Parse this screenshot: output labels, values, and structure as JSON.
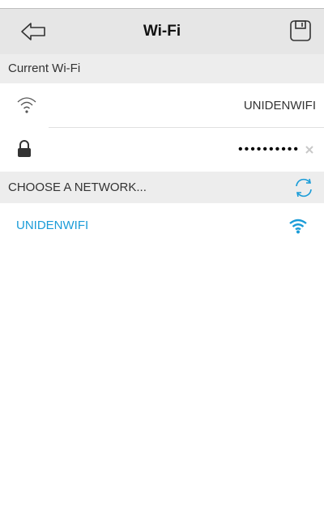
{
  "header": {
    "title": "Wi-Fi",
    "back_icon": "back-arrow-icon",
    "save_icon": "floppy-save-icon"
  },
  "current_wifi": {
    "section_label": "Current Wi-Fi",
    "ssid": "UNIDENWIFI",
    "password_masked": "••••••••••",
    "wifi_icon": "wifi-outline-icon",
    "lock_icon": "lock-icon",
    "clear_icon": "clear-x-icon"
  },
  "choose": {
    "section_label": "CHOOSE A NETWORK...",
    "refresh_icon": "refresh-icon"
  },
  "networks": [
    {
      "name": "UNIDENWIFI",
      "signal_icon": "wifi-signal-icon"
    }
  ],
  "colors": {
    "accent": "#1a9cd8",
    "header_bg": "#e6e6e6",
    "section_bg": "#ededed"
  }
}
